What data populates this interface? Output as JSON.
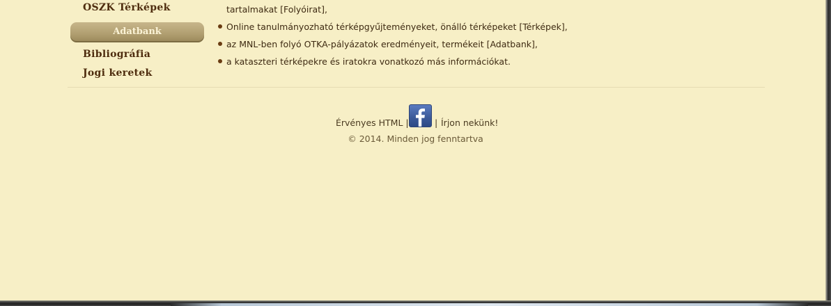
{
  "sidebar": {
    "items": [
      {
        "label": "OSZK Térképek",
        "active": false
      },
      {
        "label": "Adatbank",
        "active": true
      },
      {
        "label": "Bibliográfia",
        "active": false
      },
      {
        "label": "Jogi keretek",
        "active": false
      }
    ]
  },
  "content": {
    "continued_text": "tartalmakat [Folyóirat],",
    "bullets": [
      "Online tanulmányozható térképgyűjteményeket, önálló térképeket [Térképek],",
      "az MNL-ben folyó OTKA-pályázatok eredményeit, termékeit [Adatbank],",
      "a kataszteri térképekre és iratokra vonatkozó más információkat."
    ]
  },
  "footer": {
    "valid_html": "Érvényes HTML |",
    "separator": "|",
    "contact": "Írjon nekünk!",
    "copyright": "© 2014. Minden jog fenntartva"
  },
  "colors": {
    "background": "#f7efc6",
    "active_tab": "#b2a072",
    "link": "#4e2c0e",
    "bullet": "#6a3c12",
    "facebook": "#3b5998"
  },
  "icons": {
    "facebook": "facebook-icon"
  }
}
